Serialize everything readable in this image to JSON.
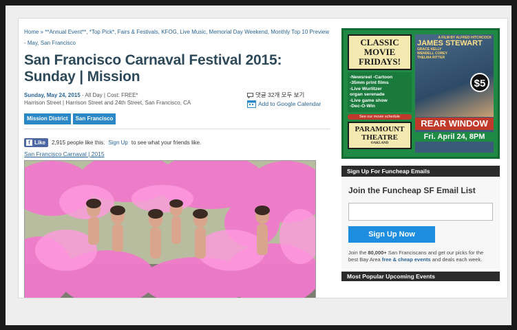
{
  "breadcrumb": "Home » **Annual Event**, *Top Pick*, Fairs & Festivals, KFOG, Live Music, Memorial Day Weekend, Monthly Top 10 Preview - May, San Francisco",
  "event": {
    "title_line1": "San Francisco Carnaval Festival 2015:",
    "title_line2": "Sunday | Mission",
    "date": "Sunday, May 24, 2015",
    "time_cost": " - All Day | Cost: FREE*",
    "address": "Harrison Street | Harrison Street and 24th Street, San Francisco, CA",
    "tags": [
      "Mission District",
      "San Francisco"
    ],
    "comments": "댓글 32개 모두 보기",
    "calendar": "Add to Google Calendar"
  },
  "facebook": {
    "like_label": "Like",
    "count_text": "2,915 people like this.",
    "signup_link": "Sign Up",
    "signup_suffix": "to see what your friends like."
  },
  "photo_link": "San Francisco Carnaval | 2015",
  "ad": {
    "left_title": "CLASSIC MOVIE FRIDAYS!",
    "list": [
      "-Newsreel  -Cartoon",
      "-35mm print films",
      "-Live Wurlitzer",
      "organ serenade",
      "-Live game show",
      "-Dec-O-Win"
    ],
    "schedule": "See our movie schedule",
    "theatre_name": "PARAMOUNT THEATRE",
    "theatre_city": "OAKLAND",
    "director": "A FILM BY ALFRED HITCHCOCK",
    "star1": "JAMES STEWART",
    "star2": "GRACE KELLY",
    "star3": "WENDELL COREY",
    "star4": "THELMA RITTER",
    "price": "$5",
    "movie": "REAR WINDOW",
    "date": "Fri. April 24, 8PM"
  },
  "sidebar": {
    "signup_header": "Sign Up For Funcheap Emails",
    "email_title": "Join the Funcheap SF Email List",
    "email_placeholder": "",
    "signup_button": "Sign Up Now",
    "promo_pre": "Join the ",
    "promo_count": "80,000+",
    "promo_mid": " San Franciscans and get our picks for the best Bay Area ",
    "promo_bold": "free & cheap events",
    "promo_post": " and deals each week.",
    "popular_header": "Most Popular Upcoming Events"
  },
  "colors": {
    "link": "#2a6496",
    "title": "#2e4a5a",
    "tag": "#2a88c8",
    "button": "#1d8de0",
    "ad_green": "#1f8a44"
  }
}
